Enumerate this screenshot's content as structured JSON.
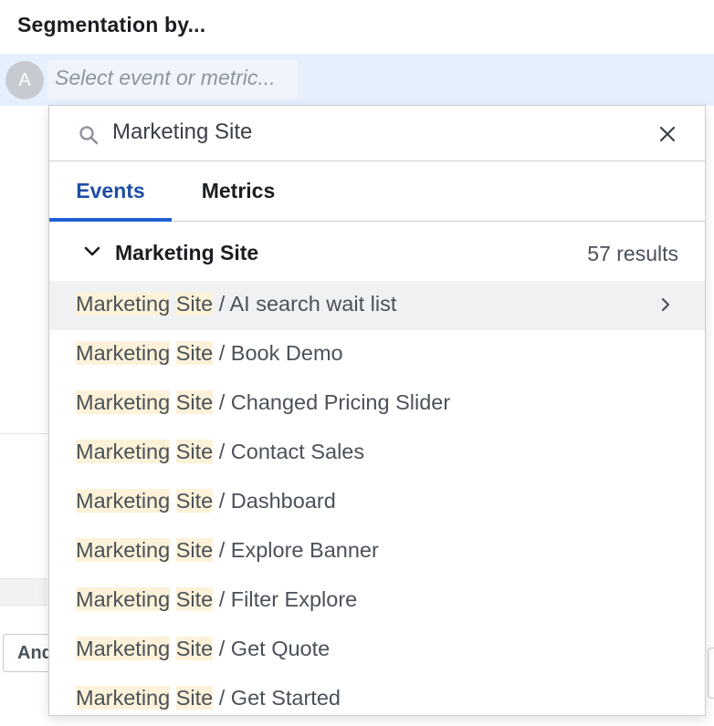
{
  "segmentation": {
    "title": "Segmentation by..."
  },
  "event_row": {
    "avatar_letter": "A",
    "placeholder": "Select event or metric..."
  },
  "background": {
    "and_button_label": "And"
  },
  "dropdown": {
    "search": {
      "value": "Marketing Site",
      "icon": "search-icon",
      "clear_icon": "close-icon"
    },
    "tabs": [
      {
        "label": "Events",
        "active": true
      },
      {
        "label": "Metrics",
        "active": false
      }
    ],
    "group": {
      "title": "Marketing Site",
      "count": "57 results",
      "expanded": true
    },
    "highlight": {
      "word1": "Marketing",
      "word2": "Site"
    },
    "results": [
      {
        "suffix": " / AI search wait list",
        "active": true
      },
      {
        "suffix": " / Book Demo"
      },
      {
        "suffix": " / Changed Pricing Slider"
      },
      {
        "suffix": " / Contact Sales"
      },
      {
        "suffix": " / Dashboard"
      },
      {
        "suffix": " / Explore Banner"
      },
      {
        "suffix": " / Filter Explore"
      },
      {
        "suffix": " / Get Quote"
      },
      {
        "suffix": " / Get Started"
      }
    ]
  },
  "colors": {
    "accent": "#1f5fd1",
    "highlight": "#fcf2d9",
    "row_selected": "#e6f0fd"
  }
}
